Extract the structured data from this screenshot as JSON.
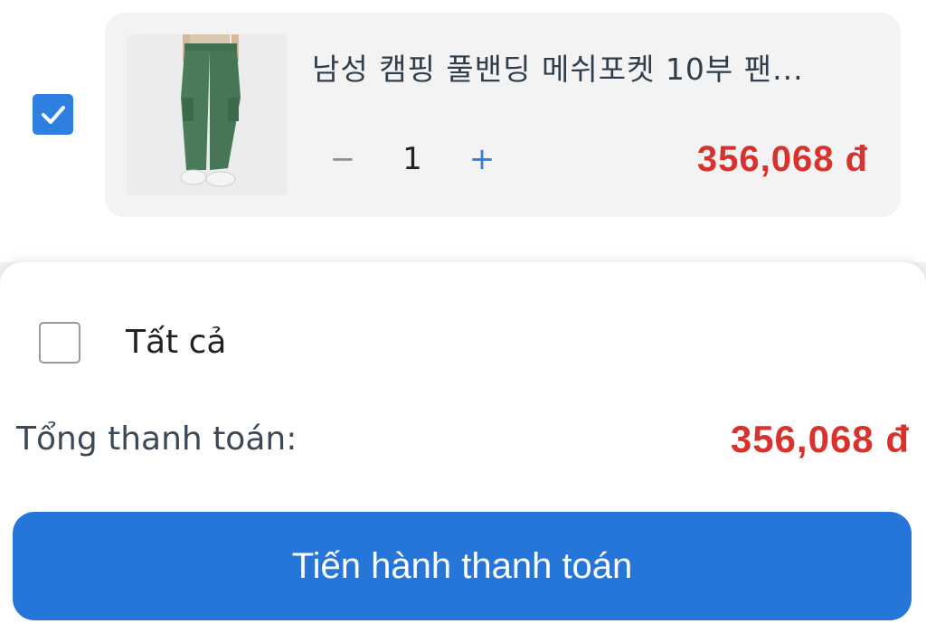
{
  "cart": {
    "item": {
      "selected": true,
      "image": "green-cargo-pants-photo",
      "title": "남성 캠핑 풀밴딩 메쉬포켓 10부 팬...",
      "qty_minus": "−",
      "quantity": "1",
      "qty_plus": "+",
      "price": "356,068 đ"
    }
  },
  "footer": {
    "select_all_label": "Tất cả",
    "select_all_checked": false,
    "total_label": "Tổng thanh toán:",
    "total_value": "356,068 đ",
    "checkout_label": "Tiến hành thanh toán"
  },
  "colors": {
    "accent": "#2576d8",
    "price": "#d9312b"
  }
}
